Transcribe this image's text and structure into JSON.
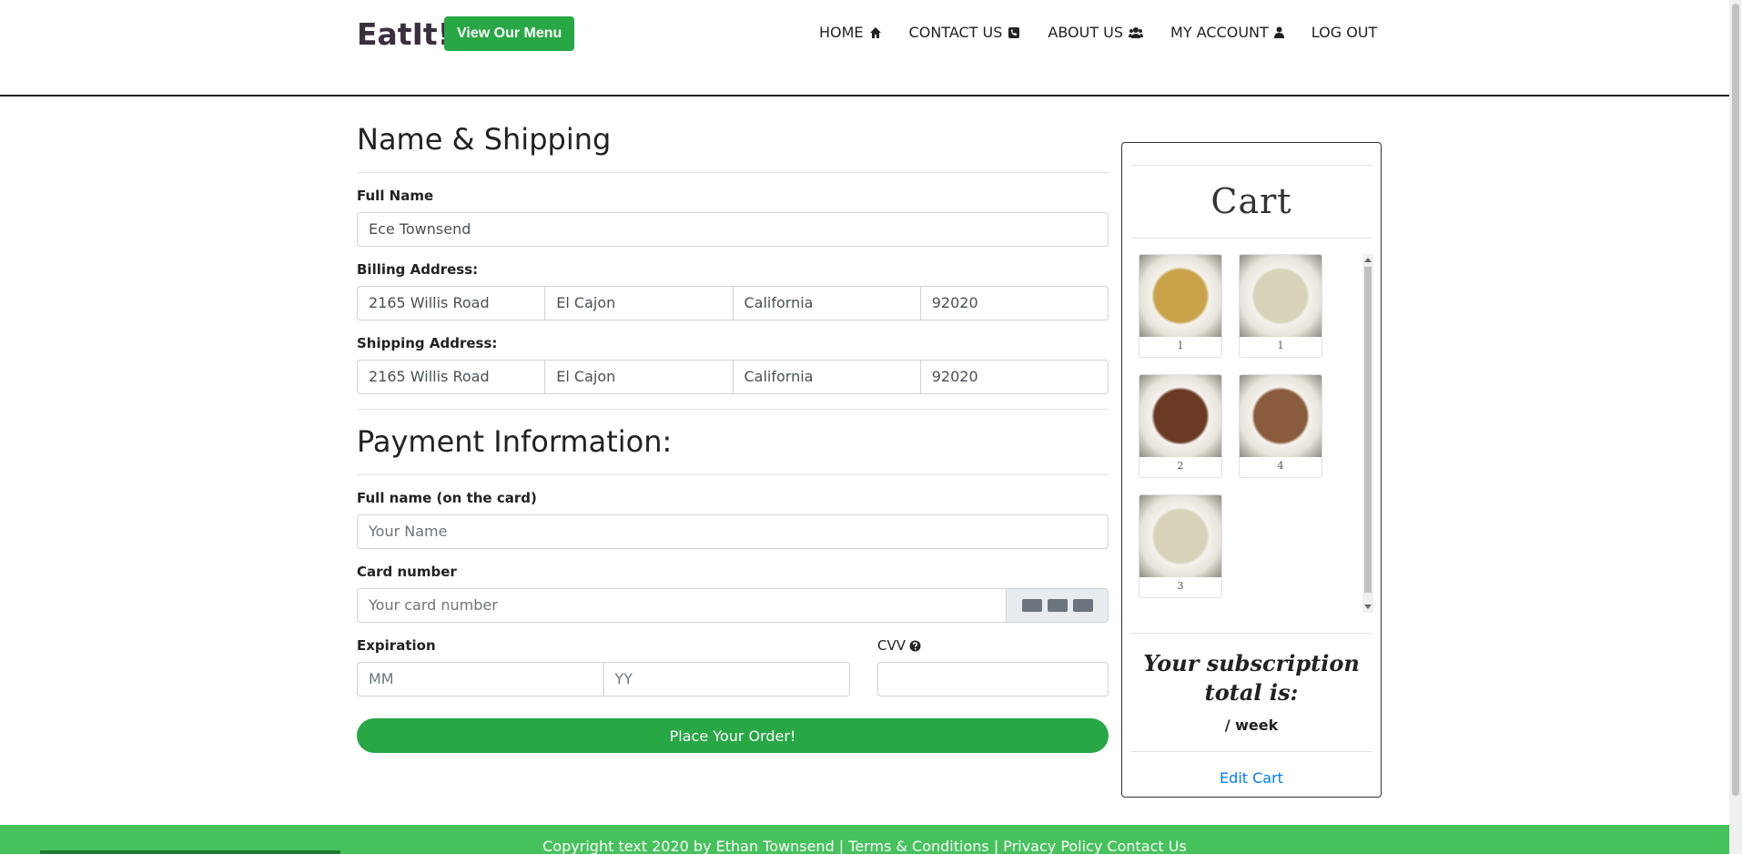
{
  "brand": "EatIt!",
  "menu_button": "View Our Menu",
  "nav": [
    {
      "label": "HOME",
      "icon": "home-icon"
    },
    {
      "label": "CONTACT US",
      "icon": "phone-icon"
    },
    {
      "label": "ABOUT US",
      "icon": "users-icon"
    },
    {
      "label": "MY ACCOUNT",
      "icon": "user-icon"
    },
    {
      "label": "LOG OUT",
      "icon": ""
    }
  ],
  "shipping": {
    "title": "Name & Shipping",
    "full_name_label": "Full Name",
    "full_name_value": "Ece Townsend",
    "billing_label": "Billing Address:",
    "billing": [
      "2165 Willis Road",
      "El Cajon",
      "California",
      "92020"
    ],
    "shipping_label": "Shipping Address:",
    "shipping": [
      "2165 Willis Road",
      "El Cajon",
      "California",
      "92020"
    ]
  },
  "payment": {
    "title": "Payment Information:",
    "card_name_label": "Full name (on the card)",
    "card_name_placeholder": "Your Name",
    "card_number_label": "Card number",
    "card_number_placeholder": "Your card number",
    "expiration_label": "Expiration",
    "mm_placeholder": "MM",
    "yy_placeholder": "YY",
    "cvv_label": "CVV",
    "order_button": "Place Your Order!"
  },
  "cart": {
    "title": "Cart",
    "items": [
      {
        "qty": "1",
        "color": "#c9a24a"
      },
      {
        "qty": "1",
        "color": "#d8d2b8"
      },
      {
        "qty": "2",
        "color": "#6b3a24"
      },
      {
        "qty": "4",
        "color": "#8a5b3c"
      },
      {
        "qty": "3",
        "color": "#d8d2b8"
      }
    ],
    "subscription_title": "Your subscription total is:",
    "per_week": "/ week",
    "edit_link": "Edit Cart"
  },
  "footer": "Copyright text 2020 by Ethan Townsend | Terms & Conditions | Privacy Policy Contact Us",
  "colors": {
    "accent": "#28a745",
    "footer": "#46c25c",
    "link": "#007bff"
  }
}
